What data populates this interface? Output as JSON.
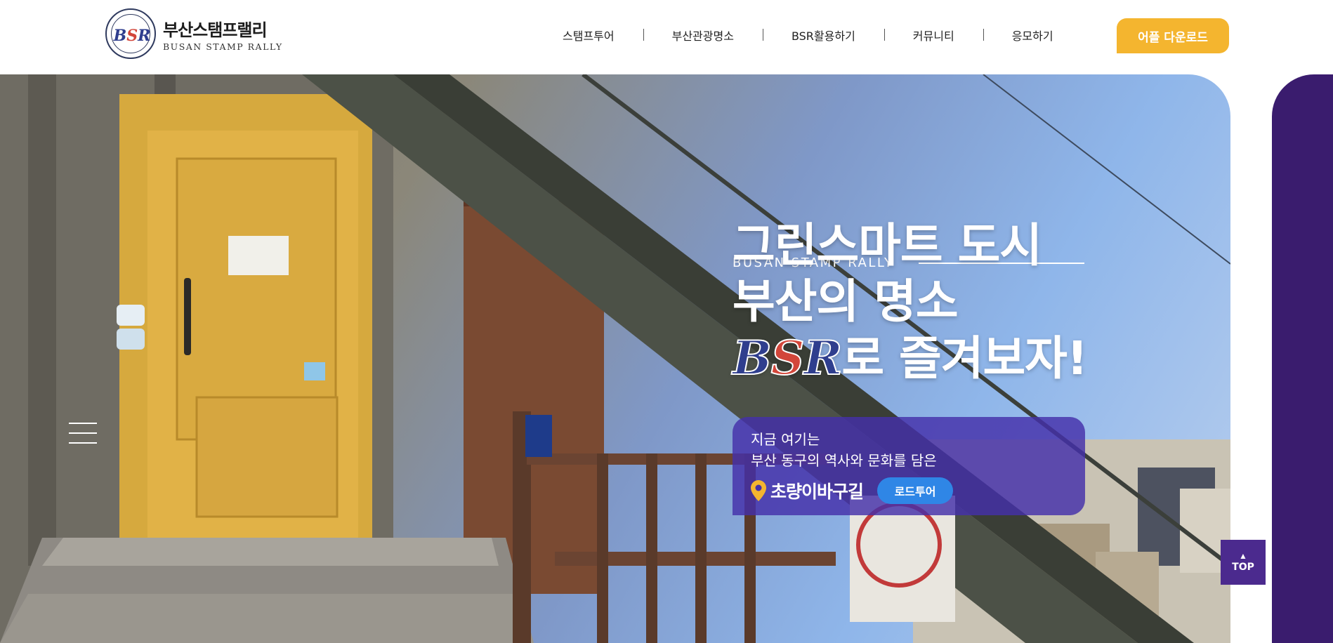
{
  "header": {
    "logo": {
      "name_ko": "부산스탬프랠리",
      "name_en": "BUSAN STAMP RALLY",
      "seal_text": "BSR"
    },
    "nav": [
      {
        "label": "스탬프투어"
      },
      {
        "label": "부산관광명소"
      },
      {
        "label": "BSR활용하기"
      },
      {
        "label": "커뮤니티"
      },
      {
        "label": "응모하기"
      }
    ],
    "app_button": "어플 다운로드"
  },
  "hero": {
    "eyebrow": "BUSAN STAMP RALLY",
    "headline": {
      "line1": "그린스마트 도시",
      "line2": "부산의 명소",
      "line3_suffix": "로 즐겨보자!",
      "bsr": {
        "b": "B",
        "s": "S",
        "r": "R"
      }
    },
    "info": {
      "line1": "지금 여기는",
      "line2": "부산 동구의 역사와 문화를 담은",
      "place": "초량이바구길",
      "button": "로드투어"
    }
  },
  "top_button": "TOP",
  "colors": {
    "accent_yellow": "#f4b52f",
    "purple": "#3a1c6e",
    "info_box": "#4430aa",
    "road_button": "#2f86e6"
  }
}
